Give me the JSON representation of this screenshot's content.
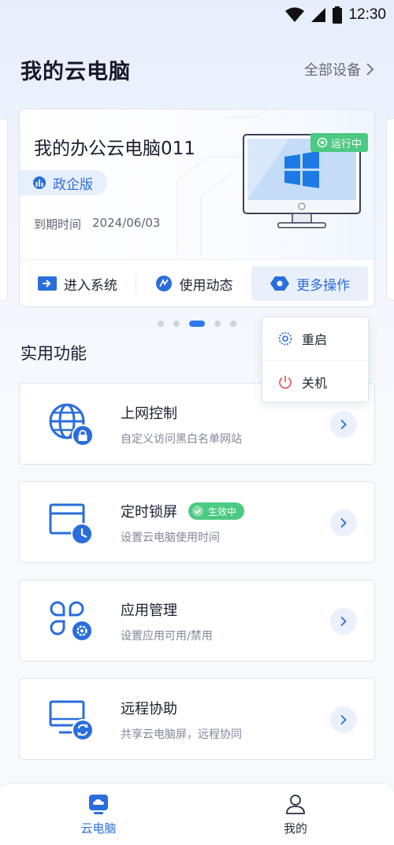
{
  "status_bar": {
    "time": "12:30",
    "icons": [
      "wifi-icon",
      "signal-icon",
      "battery-icon"
    ]
  },
  "header": {
    "title": "我的云电脑",
    "all_devices_label": "全部设备"
  },
  "pc_card": {
    "name": "我的办公云电脑011",
    "edition": "政企版",
    "expire_label": "到期时间",
    "expire_date": "2024/06/03",
    "status": "运行中",
    "actions": [
      {
        "label": "进入系统",
        "icon": "enter-system-icon"
      },
      {
        "label": "使用动态",
        "icon": "usage-activity-icon"
      },
      {
        "label": "更多操作",
        "icon": "more-operations-icon"
      }
    ]
  },
  "carousel": {
    "page_count": 5,
    "active_index": 2
  },
  "more_menu": {
    "items": [
      {
        "label": "重启",
        "icon": "restart-icon"
      },
      {
        "label": "关机",
        "icon": "power-icon"
      }
    ]
  },
  "section": {
    "title": "实用功能"
  },
  "functions": [
    {
      "title": "上网控制",
      "desc": "自定义访问黑白名单网站",
      "icon": "globe-lock-icon"
    },
    {
      "title": "定时锁屏",
      "desc": "设置云电脑使用时间",
      "icon": "screen-clock-icon",
      "badge": "生效中"
    },
    {
      "title": "应用管理",
      "desc": "设置应用可用/禁用",
      "icon": "apps-gear-icon"
    },
    {
      "title": "远程协助",
      "desc": "共享云电脑屏，远程协同",
      "icon": "monitor-sync-icon"
    }
  ],
  "tabbar": {
    "tabs": [
      {
        "label": "云电脑",
        "icon": "cloud-pc-icon",
        "active": true
      },
      {
        "label": "我的",
        "icon": "user-icon",
        "active": false
      }
    ]
  },
  "colors": {
    "primary": "#2a6ddc",
    "accent_blue": "#2f7af0",
    "success": "#4cc982",
    "danger": "#e05a5a"
  }
}
